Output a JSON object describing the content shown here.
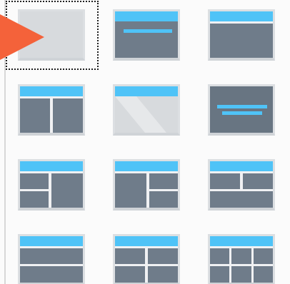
{
  "colors": {
    "header": "#4fc3f7",
    "panel": "#6f7c8a",
    "panel_dark": "#687582",
    "blank": "#d7dadd",
    "blank_diagonal": "#e6e8ea",
    "tile_border": "#dcdfe2",
    "pointer": "#f4623a"
  },
  "layout_picker": {
    "selected_index": 0,
    "tiles": [
      {
        "id": "blank",
        "icon": "layout-blank-icon"
      },
      {
        "id": "title-bar-content",
        "icon": "layout-title-content-icon"
      },
      {
        "id": "title-content",
        "icon": "layout-title-single-content-icon"
      },
      {
        "id": "title-two-columns",
        "icon": "layout-two-columns-icon"
      },
      {
        "id": "title-only",
        "icon": "layout-title-only-icon"
      },
      {
        "id": "section-header",
        "icon": "layout-section-header-icon"
      },
      {
        "id": "title-left-stack-right-big",
        "icon": "layout-left-stack-icon"
      },
      {
        "id": "title-left-big-right-stack",
        "icon": "layout-right-stack-icon"
      },
      {
        "id": "title-top-split-bottom-wide",
        "icon": "layout-top-split-icon"
      },
      {
        "id": "title-two-rows",
        "icon": "layout-two-rows-icon"
      },
      {
        "id": "title-four-grid",
        "icon": "layout-four-grid-icon"
      },
      {
        "id": "title-six-grid",
        "icon": "layout-six-grid-icon"
      }
    ]
  }
}
